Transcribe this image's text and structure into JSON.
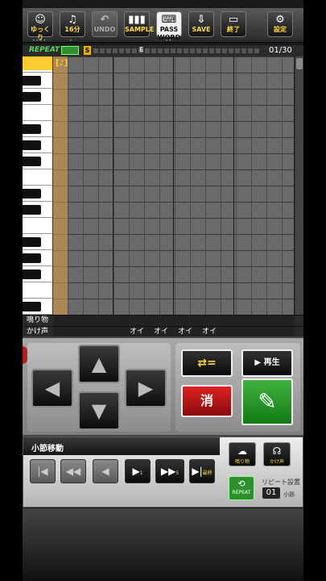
{
  "toolbar": {
    "buttons": [
      {
        "label": "ゆっくり",
        "icon": "☺"
      },
      {
        "label": "16分",
        "icon": "♫"
      },
      {
        "label": "UNDO",
        "icon": "↶"
      },
      {
        "label": "SAMPLE",
        "icon": "▮▮▮"
      },
      {
        "label": "PASS WORD",
        "icon": "⌨"
      },
      {
        "label": "SAVE",
        "icon": "⇩"
      },
      {
        "label": "終了",
        "icon": "▭"
      },
      {
        "label": "設定",
        "icon": "⚙"
      }
    ]
  },
  "position_bar": {
    "repeat_label": "REPEAT",
    "start_marker": "S",
    "end_marker": "E",
    "current": "01",
    "total": "/30"
  },
  "cursor_mark": "[♪]",
  "rows": {
    "narimono_label": "鳴り物",
    "kakegoe_label": "かけ声",
    "kakegoe_values": [
      "オイ",
      "オイ",
      "オイ",
      "オイ"
    ]
  },
  "controls": {
    "replace_label": "⇄=",
    "play_label": "再生",
    "erase_label": "消",
    "write_label": "✎"
  },
  "measure_move": {
    "title": "小節移動",
    "buttons": [
      {
        "icon": "|◀",
        "sub": "最初"
      },
      {
        "icon": "◀◀",
        "sub": "5"
      },
      {
        "icon": "◀",
        "sub": "1"
      },
      {
        "icon": "▶",
        "sub": "1"
      },
      {
        "icon": "▶▶",
        "sub": "5"
      },
      {
        "icon": "▶|",
        "sub": "最終"
      }
    ]
  },
  "side": {
    "narimono_btn": "鳴り物",
    "kakegoe_btn": "かけ声",
    "repeat_btn": "REPEAT",
    "repeat_setting_label": "リピート設置",
    "repeat_setting_value": "01",
    "repeat_setting_unit": "小節"
  }
}
